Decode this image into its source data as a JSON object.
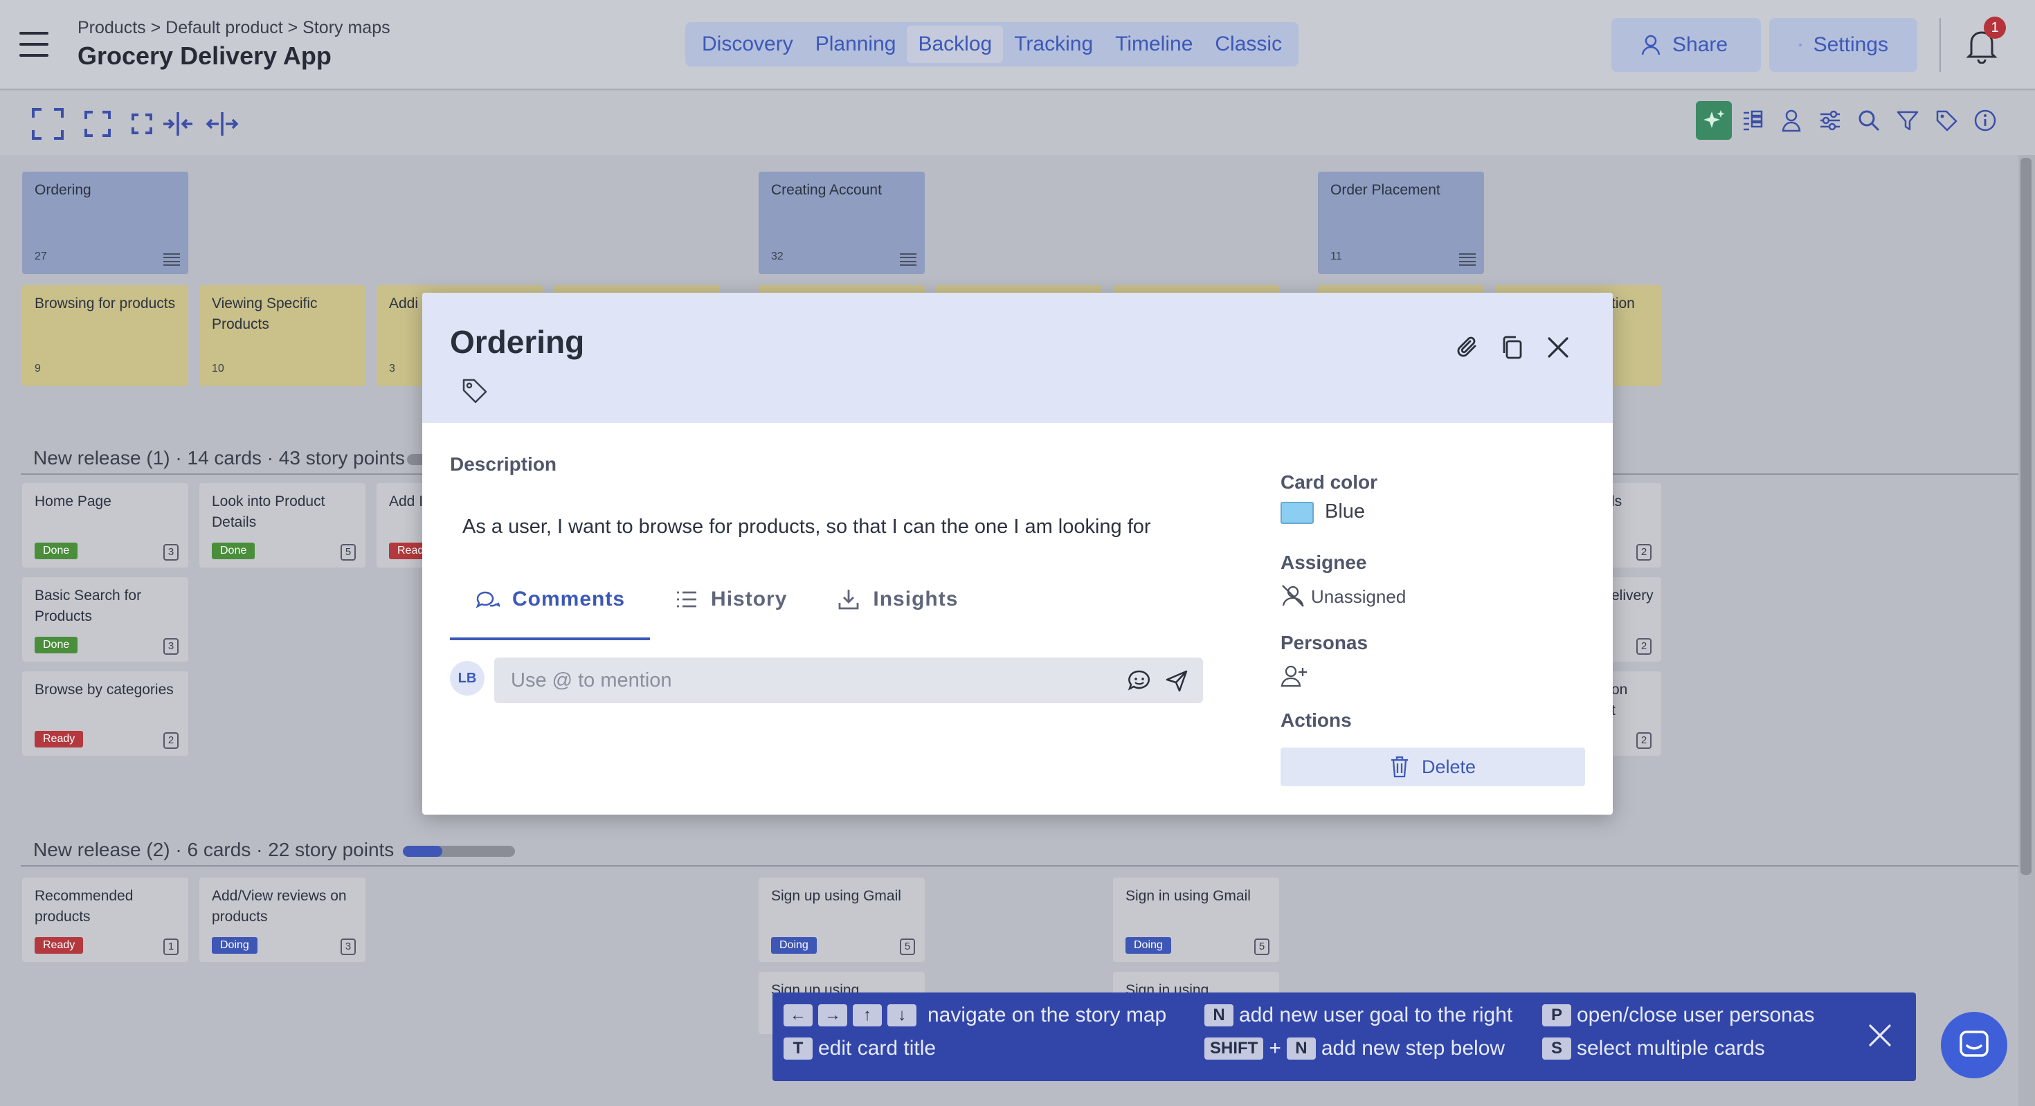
{
  "header": {
    "breadcrumb": "Products > Default product > Story maps",
    "title": "Grocery Delivery App",
    "view_tabs": [
      "Discovery",
      "Planning",
      "Backlog",
      "Tracking",
      "Timeline",
      "Classic"
    ],
    "active_tab": "Backlog",
    "share_label": "Share",
    "settings_label": "Settings",
    "notification_count": "1"
  },
  "board": {
    "goals": [
      {
        "title": "Ordering",
        "count": "27"
      },
      {
        "title": "Creating Account",
        "count": "32"
      },
      {
        "title": "Order Placement",
        "count": "11"
      }
    ],
    "steps": [
      {
        "title": "Browsing for products",
        "count": "9"
      },
      {
        "title": "Viewing Specific Products",
        "count": "10"
      },
      {
        "title": "Addi",
        "count": "3"
      },
      {
        "title": "tion",
        "count": ""
      }
    ],
    "release1": {
      "title": "New release (1) · 14 cards · 43 story points",
      "cards": [
        {
          "title": "Home Page",
          "status": "Done",
          "points": "3"
        },
        {
          "title": "Look into Product Details",
          "status": "Done",
          "points": "5"
        },
        {
          "title": "Add I",
          "status": "Read",
          "points": ""
        },
        {
          "title": "Basic Search for Products",
          "status": "Done",
          "points": "3"
        },
        {
          "title": "Browse by categories",
          "status": "Ready",
          "points": "2"
        },
        {
          "title": "ls",
          "status": "",
          "points": "2"
        },
        {
          "title": "elivery",
          "status": "",
          "points": "2"
        },
        {
          "title": "on",
          "status": "",
          "points": "2"
        },
        {
          "title": "t",
          "status": "",
          "points": ""
        }
      ]
    },
    "release2": {
      "title": "New release (2) · 6 cards · 22 story points",
      "progress": 0.35,
      "cards": [
        {
          "title": "Recommended products",
          "status": "Ready",
          "points": "1"
        },
        {
          "title": "Add/View reviews on products",
          "status": "Doing",
          "points": "3"
        },
        {
          "title": "Sign up using Gmail",
          "status": "Doing",
          "points": "5"
        },
        {
          "title": "Sign in using Gmail",
          "status": "Doing",
          "points": "5"
        },
        {
          "title": "Sign up using",
          "status": "",
          "points": ""
        },
        {
          "title": "Sign in using",
          "status": "",
          "points": ""
        }
      ]
    }
  },
  "modal": {
    "title": "Ordering",
    "description_label": "Description",
    "description": "As a user, I want to browse for products, so that I can the one I am looking for",
    "tabs": [
      "Comments",
      "History",
      "Insights"
    ],
    "active_tab": "Comments",
    "avatar_initials": "LB",
    "comment_placeholder": "Use @ to mention",
    "card_color_label": "Card color",
    "card_color_value": "Blue",
    "card_color_hex": "#8ccdf2",
    "assignee_label": "Assignee",
    "assignee_value": "Unassigned",
    "personas_label": "Personas",
    "actions_label": "Actions",
    "delete_label": "Delete"
  },
  "shortcuts": {
    "navigate_text": "navigate on the story map",
    "add_goal_key": "N",
    "add_goal_text": "add new user goal to the right",
    "personas_key": "P",
    "personas_text": "open/close user personas",
    "edit_key": "T",
    "edit_text": "edit card title",
    "shift_key": "SHIFT",
    "plus": "+",
    "add_step_key": "N",
    "add_step_text": "add new step below",
    "select_key": "S",
    "select_text": "select multiple cards"
  },
  "colors": {
    "accent": "#3c58b8",
    "done": "#4a8e3c",
    "ready": "#b3393e",
    "doing": "#3e57b6"
  }
}
